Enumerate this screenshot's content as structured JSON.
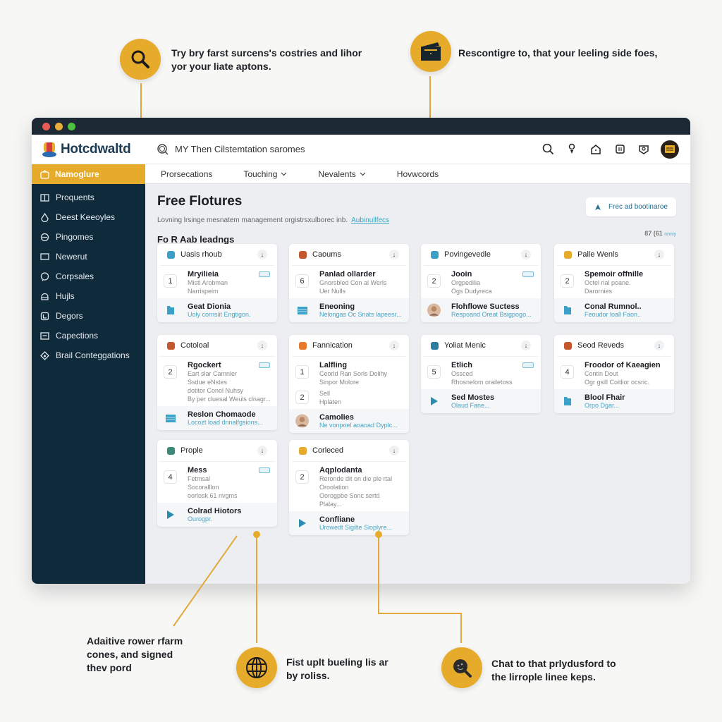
{
  "callouts": {
    "top_left": "Try bry farst surcens's costries and lihor yor your liate aptons.",
    "top_right": "Rescontigre to, that your leeling side foes,",
    "bottom_left": "Adaitive rower rfarm cones, and signed thev pord",
    "bottom_center": "Fist uplt bueling lis ar by roliss.",
    "bottom_right": "Chat to that prlydusford to the lirrople linee keps."
  },
  "app": {
    "brand": "Hotcdwaltd",
    "search_text": "MY Then Cilstemtation saromes"
  },
  "sidebar": {
    "active": "Namoglure",
    "items": [
      {
        "label": "Proquents",
        "icon": "book-icon"
      },
      {
        "label": "Deest Keeoyles",
        "icon": "drop-icon"
      },
      {
        "label": "Pingomes",
        "icon": "chat-icon"
      },
      {
        "label": "Newerut",
        "icon": "monitor-icon"
      },
      {
        "label": "Corpsales",
        "icon": "bubble-icon"
      },
      {
        "label": "Hujls",
        "icon": "helmet-icon"
      },
      {
        "label": "Degors",
        "icon": "doc-icon"
      },
      {
        "label": "Capections",
        "icon": "card-icon"
      },
      {
        "label": "Brail Conteggations",
        "icon": "diamond-icon"
      }
    ]
  },
  "subnav": [
    {
      "label": "Prorsecations",
      "dropdown": false
    },
    {
      "label": "Touching",
      "dropdown": true
    },
    {
      "label": "Nevalents",
      "dropdown": true
    },
    {
      "label": "Hovwcords",
      "dropdown": false
    }
  ],
  "page": {
    "title": "Free Flotures",
    "description": "Lovning lrsinge mesnatem management orgistrsxulborec inb.",
    "link": "Aubinullfecs",
    "section": "Fo R Aab leadngs",
    "cta": "Frec ad bootinaroe",
    "count": "87 (61",
    "count_suffix": "nnniy"
  },
  "cards": [
    {
      "title": "Uasis rhoub",
      "icon_color": "#3aa0c8",
      "num": "1",
      "row_title": "Mryilieia",
      "row_sub": [
        "Mistl Arobman",
        "Narrispeim"
      ],
      "badge": true,
      "foot_title": "Geat Dionia",
      "foot_sub": "Uoly cornsiit Engtigon.",
      "foot_icon": "folder"
    },
    {
      "title": "Caoums",
      "icon_color": "#c3582e",
      "num": "6",
      "row_title": "Panlad ollarder",
      "row_sub": [
        "Gnorsbled Con al Werls",
        "Uer Nulls"
      ],
      "badge": false,
      "foot_title": "Eneoning",
      "foot_sub": "Nelongas Oc Snats lapeesr...",
      "foot_icon": "stack"
    },
    {
      "title": "Povingevedle",
      "icon_color": "#3aa0c8",
      "num": "2",
      "row_title": "Jooin",
      "row_sub": [
        "Orgpedilia",
        "Ogs Dudyreca"
      ],
      "badge": true,
      "foot_title": "Flohflowe Suctess",
      "foot_sub": "Respoand Oreat Bsigpogo...",
      "foot_icon": "face"
    },
    {
      "title": "Palle Wenls",
      "icon_color": "#e6ab2a",
      "num": "2",
      "row_title": "Spemoir offnille",
      "row_sub": [
        "Octel rial poane.",
        "Darornies"
      ],
      "badge": false,
      "foot_title": "Conal Rumnol..",
      "foot_sub": "Feoudor loall Faon..",
      "foot_icon": "folder"
    },
    {
      "title": "Cotoloal",
      "icon_color": "#c3582e",
      "num": "2",
      "row_title": "Rgockert",
      "row_sub": [
        "Eart slar Camnler",
        "Ssdue eNstes",
        "dotitor Conol Nuhsy",
        "By per cluesal Weuls clnagr..."
      ],
      "badge": true,
      "foot_title": "Reslon Chomaode",
      "foot_sub": "Locozt load dnnalfgsions...",
      "foot_icon": "stack"
    },
    {
      "title": "Fannication",
      "icon_color": "#e67a2a",
      "num": "1",
      "row_title": "Lalfling",
      "row_sub": [
        "Ceorld Ran Sorls Dolihy",
        "Sinpor Molore"
      ],
      "num2": "2",
      "row2_sub": [
        "Sell",
        "Hplaten"
      ],
      "badge": false,
      "foot_title": "Camolies",
      "foot_sub": "Ne vonpoel aoaoad Dyplc...",
      "foot_icon": "face"
    },
    {
      "title": "Yoliat Menic",
      "icon_color": "#2a7ea0",
      "num": "5",
      "row_title": "Etlich",
      "row_sub": [
        "Ossced",
        "Rhosnelom orailetoss"
      ],
      "badge": true,
      "foot_title": "Sed Mostes",
      "foot_sub": "Olaud Fane...",
      "foot_icon": "play"
    },
    {
      "title": "Seod Reveds",
      "icon_color": "#c3582e",
      "num": "4",
      "row_title": "Froodor of Kaeagien",
      "row_sub": [
        "Contin Dout",
        "Ogr gsill Coitlior ocsric."
      ],
      "badge": false,
      "foot_title": "Blool Fhair",
      "foot_sub": "Orpo Dgar...",
      "foot_icon": "folder"
    },
    {
      "title": "Prople",
      "icon_color": "#3a8a7a",
      "num": "4",
      "row_title": "Mess",
      "row_sub": [
        "Fetmsal",
        "Socoralllon",
        "oorlosk 61 nvgms"
      ],
      "badge": true,
      "foot_title": "Colrad Hiotors",
      "foot_sub": "Ourogpr.",
      "foot_icon": "play"
    },
    {
      "title": "Corleced",
      "icon_color": "#e6ab2a",
      "num": "2",
      "row_title": "Aqplodanta",
      "row_sub": [
        "Reronde dit on die ple rtal",
        "Oroolation",
        "Oorogpbe Sonc sertd Plalay..."
      ],
      "badge": false,
      "foot_title": "Confliane",
      "foot_sub": "Urowedt Sigilte Sioplyre...",
      "foot_icon": "play"
    }
  ],
  "colors": {
    "accent": "#e6ab2a",
    "sidebar": "#0f2a3a",
    "titlebar": "#1d2a35",
    "link": "#3ba6c4"
  }
}
